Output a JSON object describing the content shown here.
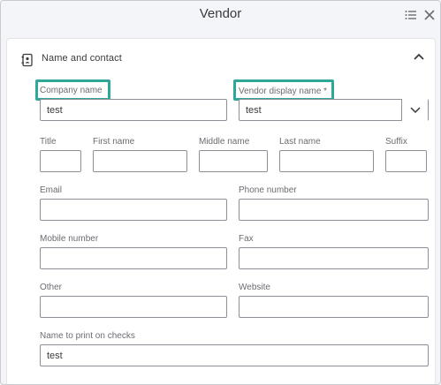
{
  "header": {
    "title": "Vendor"
  },
  "section": {
    "title": "Name and contact"
  },
  "fields": {
    "company_name": {
      "label": "Company name",
      "value": "test"
    },
    "display_name": {
      "label": "Vendor display name *",
      "value": "test"
    },
    "title": {
      "label": "Title",
      "value": ""
    },
    "first_name": {
      "label": "First name",
      "value": ""
    },
    "middle_name": {
      "label": "Middle name",
      "value": ""
    },
    "last_name": {
      "label": "Last name",
      "value": ""
    },
    "suffix": {
      "label": "Suffix",
      "value": ""
    },
    "email": {
      "label": "Email",
      "value": ""
    },
    "phone": {
      "label": "Phone number",
      "value": ""
    },
    "mobile": {
      "label": "Mobile number",
      "value": ""
    },
    "fax": {
      "label": "Fax",
      "value": ""
    },
    "other": {
      "label": "Other",
      "value": ""
    },
    "website": {
      "label": "Website",
      "value": ""
    },
    "print_on_checks": {
      "label": "Name to print on checks",
      "value": "test"
    }
  },
  "colors": {
    "highlight": "#2ea798",
    "border": "#8d9096",
    "label": "#6b6c72"
  },
  "icons": {
    "menu": "list-menu-icon",
    "close": "close-icon",
    "section": "contact-card-icon",
    "collapse": "chevron-up-icon",
    "dropdown": "chevron-down-icon"
  }
}
